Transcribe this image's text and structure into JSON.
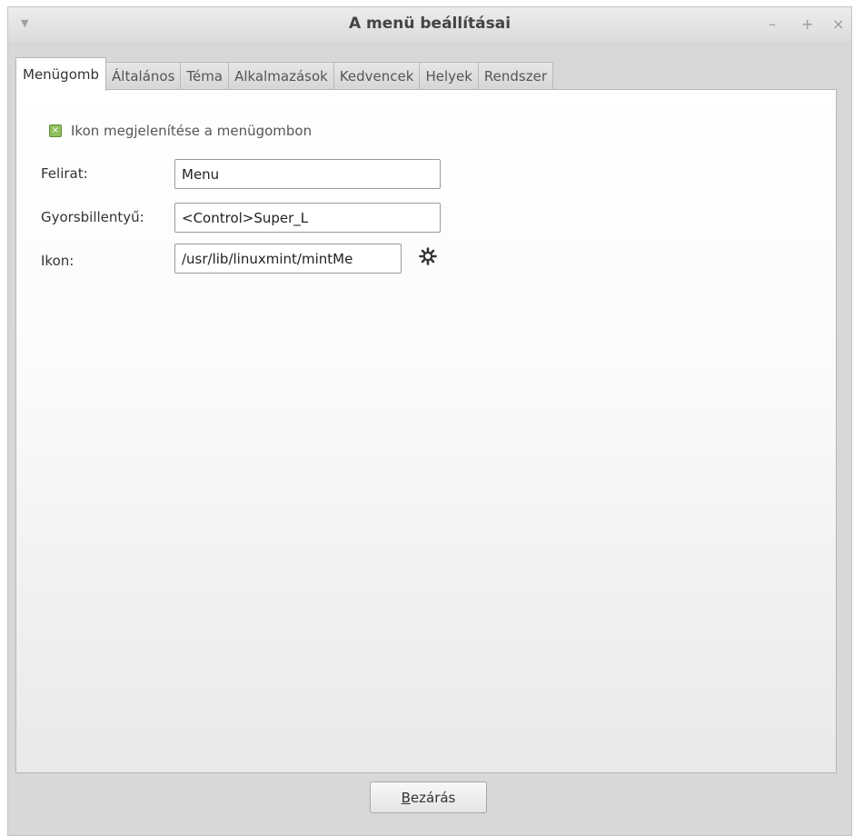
{
  "window": {
    "title": "A menü beállításai",
    "controls": {
      "minimize": "–",
      "maximize": "+",
      "close": "×"
    }
  },
  "tabs": [
    {
      "label": "Menügomb",
      "active": true
    },
    {
      "label": "Általános",
      "active": false
    },
    {
      "label": "Téma",
      "active": false
    },
    {
      "label": "Alkalmazások",
      "active": false
    },
    {
      "label": "Kedvencek",
      "active": false
    },
    {
      "label": "Helyek",
      "active": false
    },
    {
      "label": "Rendszer",
      "active": false
    }
  ],
  "menu_button": {
    "show_icon_label": "Ikon megjelenítése a menügombon",
    "show_icon_checked": true,
    "caption_label": "Felirat:",
    "caption_value": "Menu",
    "hotkey_label": "Gyorsbillentyű:",
    "hotkey_value": "<Control>Super_L",
    "icon_label": "Ikon:",
    "icon_value": "/usr/lib/linuxmint/mintMe",
    "icon_chooser": "gear-icon"
  },
  "footer": {
    "close_label_mnemonic": "B",
    "close_label_rest": "ezárás"
  },
  "colors": {
    "checkbox_accent": "#8fbf5a"
  }
}
